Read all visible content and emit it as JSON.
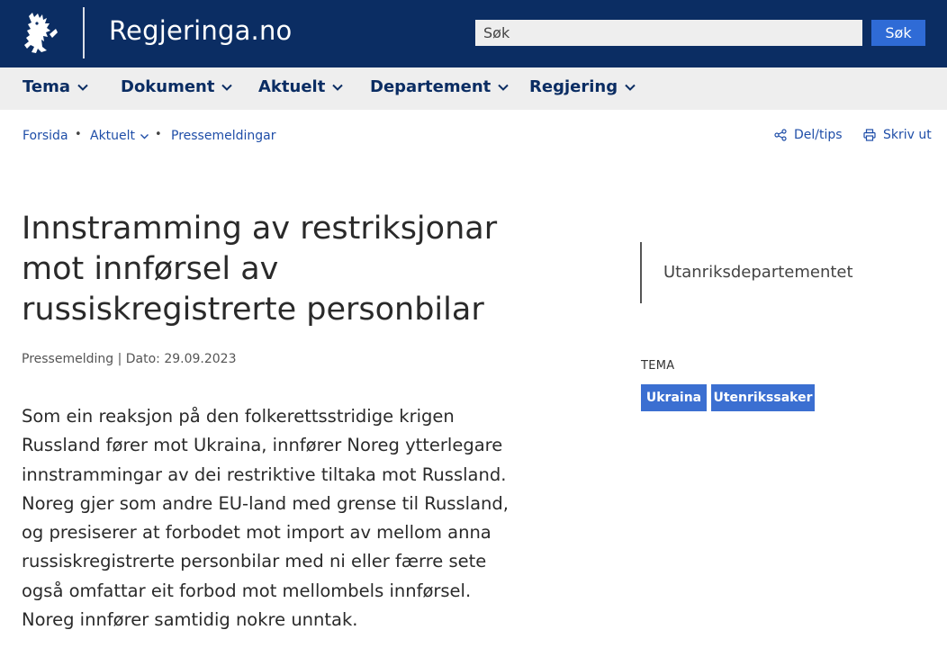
{
  "header": {
    "site_name": "Regjeringa.no",
    "logo_icon": "lion-crest-icon",
    "search": {
      "placeholder": "Søk",
      "value": "",
      "button_label": "Søk"
    },
    "colors": {
      "background": "#0b2d63",
      "search_button": "#2f6bd6"
    }
  },
  "nav": {
    "items": [
      {
        "label": "Tema"
      },
      {
        "label": "Dokument"
      },
      {
        "label": "Aktuelt"
      },
      {
        "label": "Departement"
      },
      {
        "label": "Regjering"
      }
    ]
  },
  "breadcrumb": {
    "items": [
      {
        "label": "Forsida"
      },
      {
        "label": "Aktuelt"
      },
      {
        "label": "Pressemeldingar"
      }
    ],
    "separator": "•"
  },
  "tools": {
    "share_label": "Del/tips",
    "print_label": "Skriv ut"
  },
  "article": {
    "title": "Innstramming av restriksjonar mot innførsel av russiskregistrerte personbilar",
    "meta": "Pressemelding | Dato: 29.09.2023",
    "lead": "Som ein reaksjon på den folkerettsstridige krigen Russland fører mot Ukraina, innfører Noreg ytterlegare innstrammingar av dei restriktive tiltaka mot Russland. Noreg gjer som andre EU-land med grense til Russland, og presiserer at forbodet mot import av mellom anna russiskregistrerte personbilar med ni eller færre sete også omfattar eit forbod mot mellombels innførsel. Noreg innfører samtidig nokre unntak."
  },
  "sidebar": {
    "department": "Utanriksdepartementet",
    "tema_label": "TEMA",
    "tags": [
      {
        "label": "Ukraina"
      },
      {
        "label": "Utenrikssaker"
      }
    ],
    "tag_color": "#3b6fd1"
  }
}
